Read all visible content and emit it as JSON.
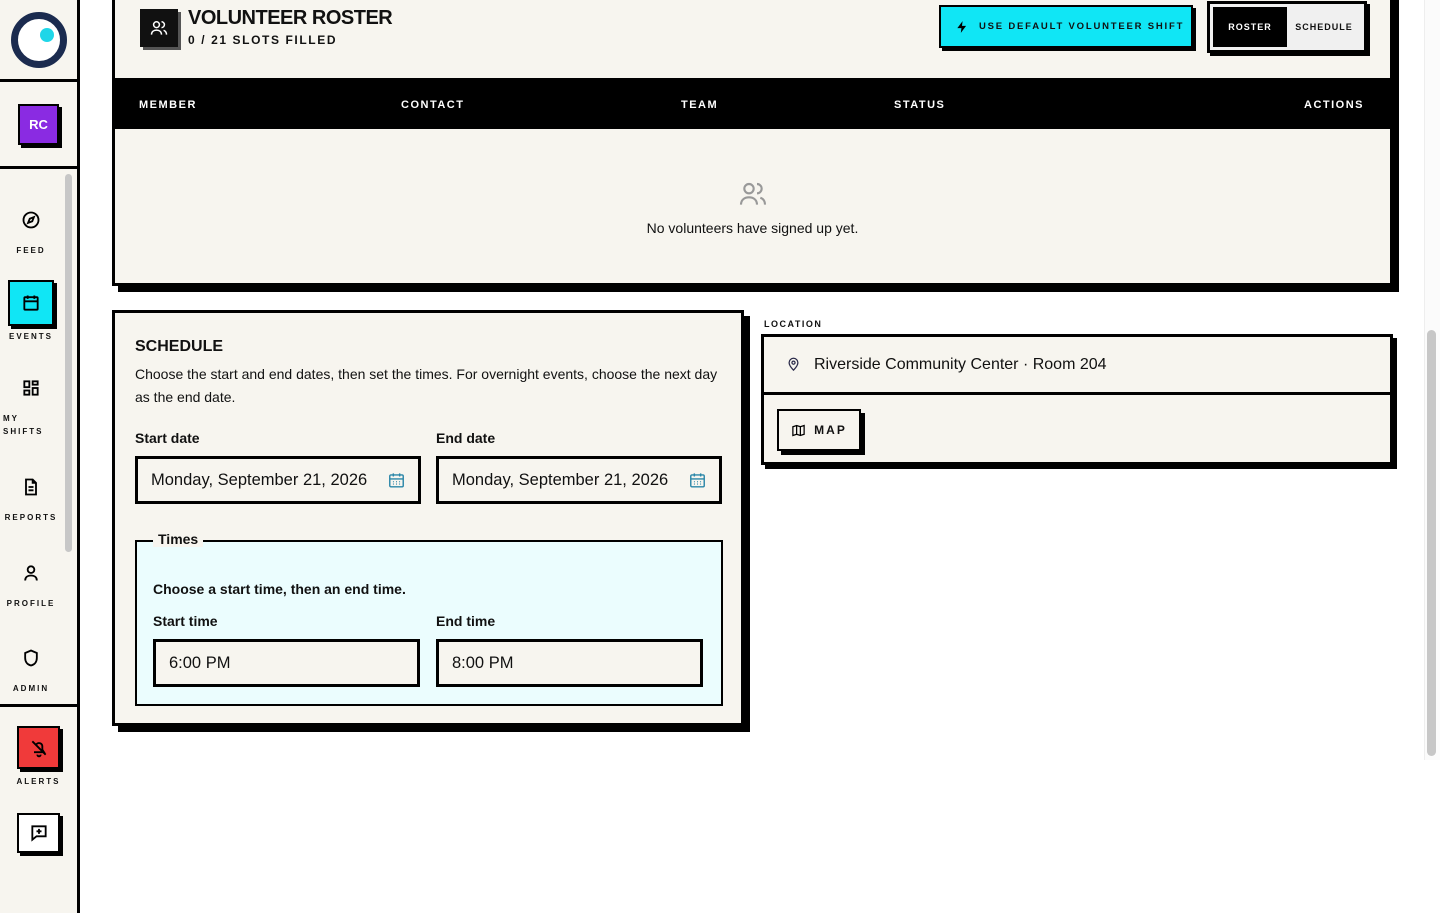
{
  "sidebar": {
    "avatar_initials": "RC",
    "nav": [
      {
        "label": "FEED",
        "icon": "compass-icon"
      },
      {
        "label": "EVENTS",
        "icon": "calendar-icon",
        "active": true
      },
      {
        "label": "MY SHIFTS",
        "icon": "grid-icon"
      },
      {
        "label": "REPORTS",
        "icon": "document-icon"
      },
      {
        "label": "PROFILE",
        "icon": "user-icon"
      },
      {
        "label": "ADMIN",
        "icon": "shield-icon"
      }
    ],
    "alerts_label": "ALERTS"
  },
  "roster": {
    "title": "VOLUNTEER ROSTER",
    "subtitle": "0 / 21 SLOTS FILLED",
    "default_button": "USE DEFAULT VOLUNTEER SHIFT",
    "toggle": {
      "roster": "ROSTER",
      "schedule": "SCHEDULE",
      "active": "roster"
    },
    "columns": [
      "MEMBER",
      "CONTACT",
      "TEAM",
      "STATUS",
      "ACTIONS"
    ],
    "empty_text": "No volunteers have signed up yet."
  },
  "schedule": {
    "title": "SCHEDULE",
    "description": "Choose the start and end dates, then set the times. For overnight events, choose the next day as the end date.",
    "start_date_label": "Start date",
    "start_date_value": "Monday, September 21, 2026",
    "end_date_label": "End date",
    "end_date_value": "Monday, September 21, 2026",
    "times_legend": "Times",
    "times_hint": "Choose a start time, then an end time.",
    "start_time_label": "Start time",
    "start_time_value": "6:00 PM",
    "end_time_label": "End time",
    "end_time_value": "8:00 PM"
  },
  "location": {
    "label": "LOCATION",
    "address": "Riverside Community Center · Room 204",
    "map_button": "MAP"
  },
  "colors": {
    "accent": "#10e6f5",
    "avatar": "#8a2be2",
    "alert": "#f03a3a",
    "card_bg": "#f7f5ef",
    "times_bg": "#ebfdfe"
  }
}
